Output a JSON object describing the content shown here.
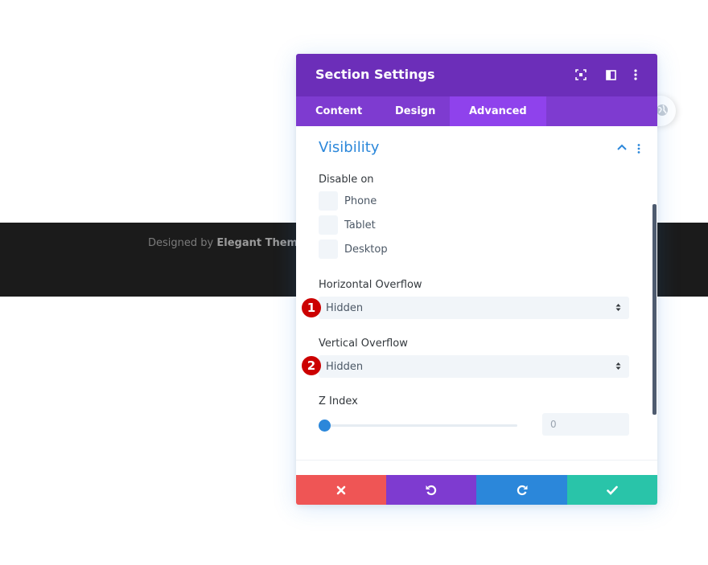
{
  "page": {
    "credit_prefix": "Designed by",
    "credit_brand": "Elegant Themes"
  },
  "modal": {
    "title": "Section Settings",
    "header_icons": [
      "expand-icon",
      "split-view-icon",
      "more-vertical-icon"
    ],
    "tabs": [
      {
        "label": "Content",
        "active": false
      },
      {
        "label": "Design",
        "active": false
      },
      {
        "label": "Advanced",
        "active": true
      }
    ],
    "section": {
      "title": "Visibility",
      "disable_on": {
        "label": "Disable on",
        "options": [
          "Phone",
          "Tablet",
          "Desktop"
        ]
      },
      "horizontal_overflow": {
        "label": "Horizontal Overflow",
        "value": "Hidden",
        "callout": "1"
      },
      "vertical_overflow": {
        "label": "Vertical Overflow",
        "value": "Hidden",
        "callout": "2"
      },
      "z_index": {
        "label": "Z Index",
        "value": "0",
        "slider_fraction": 0
      }
    },
    "footer_icons": [
      "close-icon",
      "undo-icon",
      "redo-icon",
      "check-icon"
    ]
  },
  "colors": {
    "header": "#6c2eb9",
    "tabs": "#7e3bd0",
    "tab_active": "#8f42ec",
    "accent_blue": "#2b87da",
    "cancel": "#ef5555",
    "undo": "#7e3bd0",
    "redo": "#2b87da",
    "save": "#29c4a9",
    "callout": "#cc0000"
  }
}
